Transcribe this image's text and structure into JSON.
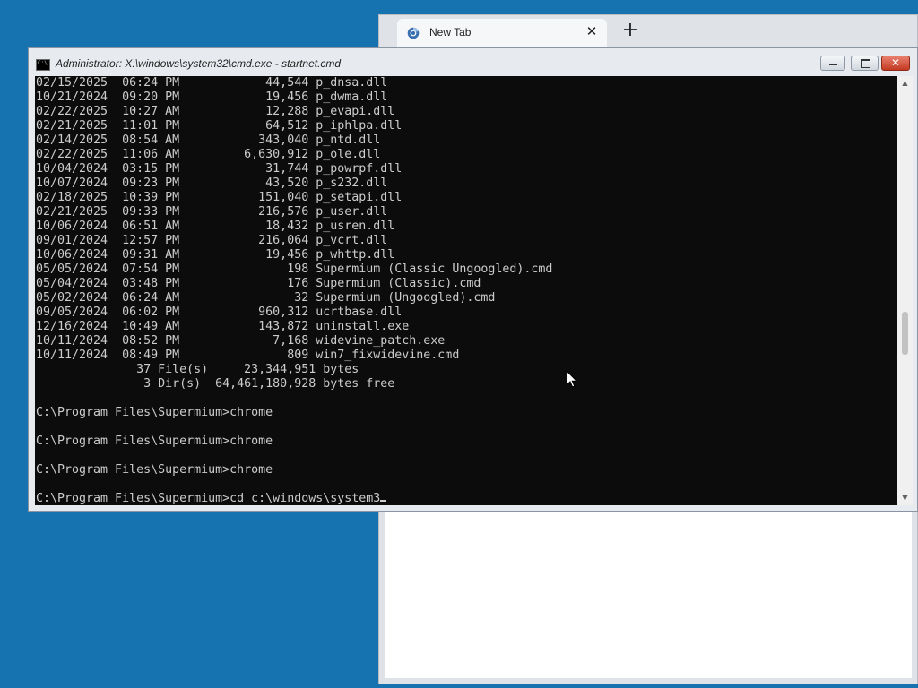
{
  "browser": {
    "tab_title": "New Tab",
    "tab_close_glyph": "✕",
    "new_tab_glyph": "+",
    "tab_icon": "supermium-logo-icon"
  },
  "cmd": {
    "title": "Administrator: X:\\windows\\system32\\cmd.exe - startnet.cmd",
    "app_icon_text": "C:\\",
    "close_glyph": "✕",
    "scroll_position": 0.62,
    "lines": [
      "02/15/2025  06:24 PM            44,544 p_dnsa.dll",
      "10/21/2024  09:20 PM            19,456 p_dwma.dll",
      "02/22/2025  10:27 AM            12,288 p_evapi.dll",
      "02/21/2025  11:01 PM            64,512 p_iphlpa.dll",
      "02/14/2025  08:54 AM           343,040 p_ntd.dll",
      "02/22/2025  11:06 AM         6,630,912 p_ole.dll",
      "10/04/2024  03:15 PM            31,744 p_powrpf.dll",
      "10/07/2024  09:23 PM            43,520 p_s232.dll",
      "02/18/2025  10:39 PM           151,040 p_setapi.dll",
      "02/21/2025  09:33 PM           216,576 p_user.dll",
      "10/06/2024  06:51 AM            18,432 p_usren.dll",
      "09/01/2024  12:57 PM           216,064 p_vcrt.dll",
      "10/06/2024  09:31 AM            19,456 p_whttp.dll",
      "05/05/2024  07:54 PM               198 Supermium (Classic Ungoogled).cmd",
      "05/04/2024  03:48 PM               176 Supermium (Classic).cmd",
      "05/02/2024  06:24 AM                32 Supermium (Ungoogled).cmd",
      "09/05/2024  06:02 PM           960,312 ucrtbase.dll",
      "12/16/2024  10:49 AM           143,872 uninstall.exe",
      "10/11/2024  08:52 PM             7,168 widevine_patch.exe",
      "10/11/2024  08:49 PM               809 win7_fixwidevine.cmd",
      "              37 File(s)     23,344,951 bytes",
      "               3 Dir(s)  64,461,180,928 bytes free",
      "",
      "C:\\Program Files\\Supermium>chrome",
      "",
      "C:\\Program Files\\Supermium>chrome",
      "",
      "C:\\Program Files\\Supermium>chrome",
      ""
    ],
    "prompt_line": "C:\\Program Files\\Supermium>cd c:\\windows\\system3"
  }
}
